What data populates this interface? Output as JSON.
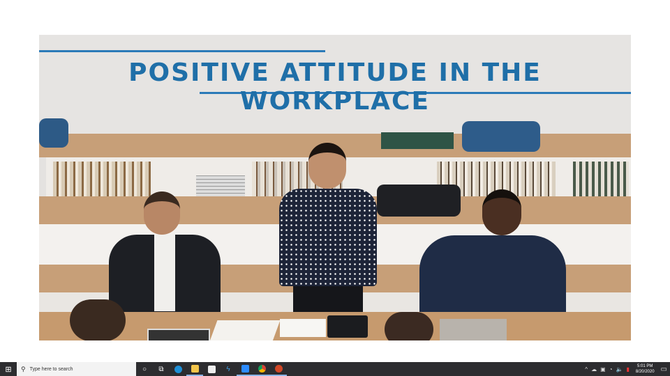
{
  "slide": {
    "title": "POSITIVE ATTITUDE IN THE WORKPLACE",
    "accent_color": "#2b7ab8"
  },
  "taskbar": {
    "start_icon": "windows-icon",
    "search_placeholder": "Type here to search",
    "apps": [
      "cortana-icon",
      "task-view-icon",
      "edge-icon",
      "file-explorer-icon",
      "store-icon",
      "vscode-icon",
      "zoom-icon",
      "chrome-icon",
      "powerpoint-icon"
    ],
    "time": "5:01 PM",
    "date": "8/20/2020"
  }
}
